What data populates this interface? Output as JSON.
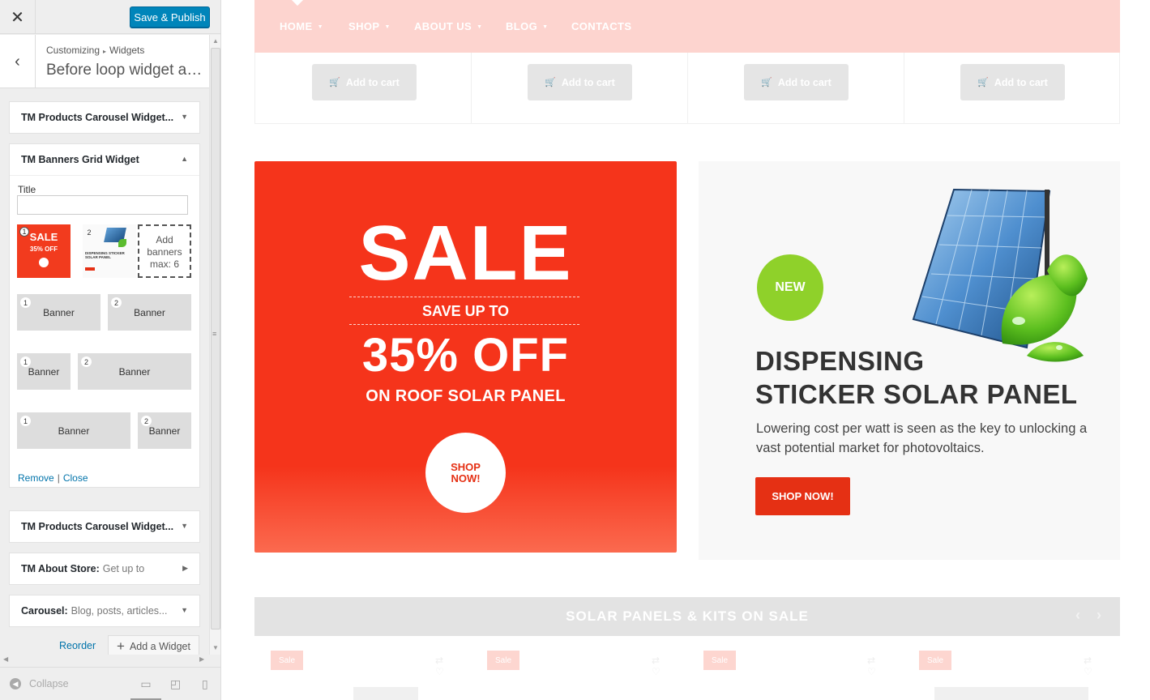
{
  "customizer": {
    "save_label": "Save & Publish",
    "close_glyph": "✕",
    "breadcrumb": {
      "root": "Customizing",
      "sep": "▸",
      "child": "Widgets"
    },
    "back_glyph": "‹",
    "section_title": "Before loop widget area",
    "widgets": [
      {
        "title": "TM Products Carousel Widget...",
        "sub": "",
        "caret": "▼"
      },
      {
        "title": "TM Banners Grid Widget",
        "sub": "",
        "caret": "▲"
      },
      {
        "title": "TM Products Carousel Widget...",
        "sub": "",
        "caret": "▼"
      },
      {
        "title": "TM About Store:",
        "sub": "Get up to",
        "caret": "▶"
      },
      {
        "title": "Carousel:",
        "sub": "Blog, posts, articles...",
        "caret": "▼"
      }
    ],
    "banners_form": {
      "title_label": "Title",
      "title_value": "",
      "thumb1": {
        "num": "1",
        "sale": "SALE",
        "off": "35% OFF"
      },
      "thumb2": {
        "num": "2",
        "text": "DISPENSING STICKER SOLAR PANEL"
      },
      "add_banners": "Add banners max: 6",
      "layouts": [
        [
          {
            "num": "1",
            "label": "Banner"
          },
          {
            "num": "2",
            "label": "Banner"
          }
        ],
        [
          {
            "num": "1",
            "label": "Banner"
          },
          {
            "num": "2",
            "label": "Banner"
          }
        ],
        [
          {
            "num": "1",
            "label": "Banner"
          },
          {
            "num": "2",
            "label": "Banner"
          }
        ]
      ],
      "remove_label": "Remove",
      "link_sep": "|",
      "close_label": "Close"
    },
    "reorder_label": "Reorder",
    "add_widget_label": "Add a Widget",
    "collapse_label": "Collapse",
    "devices": [
      "desktop-icon",
      "tablet-icon",
      "mobile-icon"
    ]
  },
  "preview": {
    "nav": [
      {
        "label": "HOME",
        "chevron": true
      },
      {
        "label": "SHOP",
        "chevron": true
      },
      {
        "label": "ABOUT US",
        "chevron": true
      },
      {
        "label": "BLOG",
        "chevron": true
      },
      {
        "label": "CONTACTS",
        "chevron": false
      }
    ],
    "add_to_cart": [
      "Add to cart",
      "Add to cart",
      "Add to cart",
      "Add to cart"
    ],
    "sale_banner": {
      "big": "SALE",
      "save_up": "SAVE UP TO",
      "percent": "35% OFF",
      "subline": "ON ROOF SOLAR PANEL",
      "cta": "SHOP NOW!",
      "bg_color": "#f5341b"
    },
    "solar_banner": {
      "badge": "NEW",
      "heading_1": "DISPENSING",
      "heading_2": "STICKER SOLAR PANEL",
      "text": "Lowering cost per watt is seen as the key to unlocking a vast potential market for photovoltaics.",
      "cta": "SHOP NOW!",
      "accent": "#e53014",
      "badge_color": "#8fd12a"
    },
    "carousel_title": "SOLAR PANELS & KITS ON SALE",
    "sale_tags": [
      "Sale",
      "Sale",
      "Sale",
      "Sale"
    ]
  }
}
